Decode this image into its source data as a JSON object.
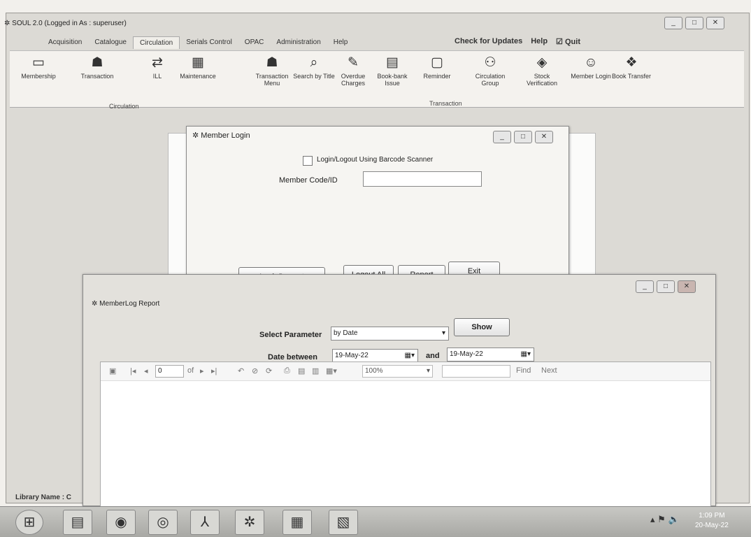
{
  "window": {
    "title": "SOUL 2.0 (Logged in As : superuser)",
    "controls": [
      "_",
      "□",
      "✕"
    ]
  },
  "menu": {
    "tabs": [
      "Acquisition",
      "Catalogue",
      "Circulation",
      "Serials Control",
      "OPAC",
      "Administration",
      "Help"
    ],
    "active": "Circulation",
    "check_updates": "Check for Updates",
    "help": "Help",
    "quit": "Quit"
  },
  "ribbon": {
    "items": [
      {
        "label": "Membership",
        "icon": "id-card-icon"
      },
      {
        "label": "Transaction",
        "icon": "people-icon"
      },
      {
        "label": "ILL",
        "icon": "exchange-icon"
      },
      {
        "label": "Maintenance",
        "icon": "toolbox-icon"
      },
      {
        "label": "Transaction Menu",
        "icon": "people-icon"
      },
      {
        "label": "Search by Title",
        "icon": "search-book-icon"
      },
      {
        "label": "Overdue Charges",
        "icon": "charges-icon"
      },
      {
        "label": "Book-bank Issue",
        "icon": "books-icon"
      },
      {
        "label": "Reminder",
        "icon": "reminder-icon"
      },
      {
        "label": "Circulation Group",
        "icon": "group-icon"
      },
      {
        "label": "Stock Verification",
        "icon": "stock-icon"
      },
      {
        "label": "Member Login",
        "icon": "member-icon"
      },
      {
        "label": "Book Transfer",
        "icon": "transfer-icon"
      }
    ],
    "group_circulation": "Circulation",
    "group_transaction": "Transaction"
  },
  "member_login": {
    "title": "Member Login",
    "barcode_label": "Login/Logout Using Barcode Scanner",
    "code_label": "Member Code/ID",
    "code_value": "",
    "buttons": {
      "login": "Login/Logout",
      "logout_all": "Logout All",
      "report": "Report",
      "exit": "Exit"
    }
  },
  "report": {
    "title": "MemberLog Report",
    "param_label": "Select Parameter",
    "param_value": "by Date",
    "show_button": "Show",
    "date_label": "Date between",
    "date_from": "19-May-22",
    "and_label": "and",
    "date_to": "19-May-22",
    "viewer": {
      "page": "0",
      "of_label": "of",
      "zoom": "100%",
      "find": "Find",
      "next": "Next"
    }
  },
  "status": {
    "library_name": "Library Name : C"
  },
  "taskbar": {
    "time": "1:09 PM",
    "date": "20-May-22"
  }
}
